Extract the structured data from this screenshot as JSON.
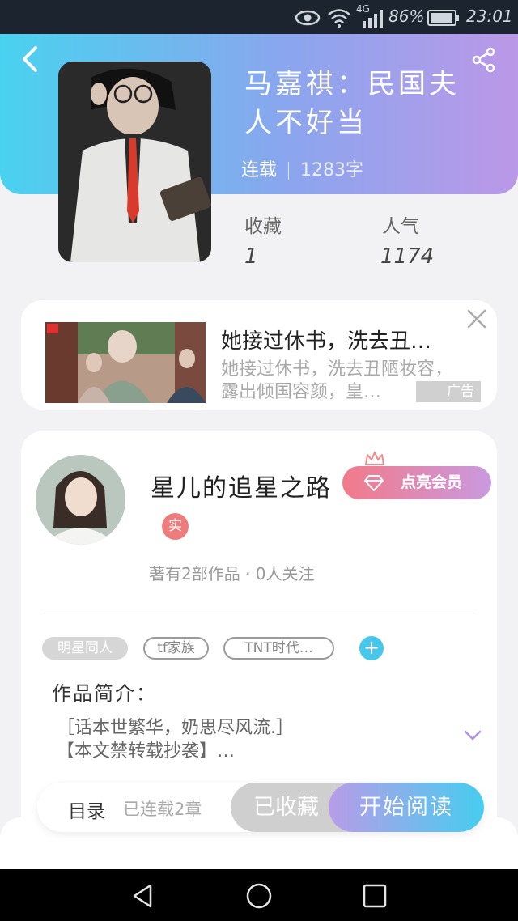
{
  "status_bar": {
    "network": "4G",
    "battery": "86%",
    "time": "23:01"
  },
  "book": {
    "title": "马嘉祺：民国夫人不好当",
    "status": "连载",
    "word_count": "1283字",
    "stats": [
      {
        "label": "收藏",
        "value": "1"
      },
      {
        "label": "人气",
        "value": "1174"
      }
    ]
  },
  "ad": {
    "title": "她接过休书，洗去丑…",
    "description": "她接过休书，洗去丑陋妆容，露出倾国容颜，皇…",
    "badge": "广告"
  },
  "author": {
    "name": "星儿的追星之路",
    "verified_label": "实",
    "vip_button": "点亮会员",
    "stats": "著有2部作品 · 0人关注"
  },
  "tags": [
    "明星同人",
    "tf家族",
    "TNT时代…"
  ],
  "intro": {
    "label": "作品简介：",
    "text": "［话本世繁华，奶思尽风流.］\n【本文禁转载抄袭】…"
  },
  "action_bar": {
    "toc_label": "目录",
    "toc_status": "已连载2章",
    "favorite_label": "已收藏",
    "read_label": "开始阅读"
  },
  "colors": {
    "header_gradient_start": "#49d2ef",
    "header_gradient_end": "#bb98e8",
    "accent_blue": "#46c7ec",
    "vip_pink": "#f27a8a"
  }
}
